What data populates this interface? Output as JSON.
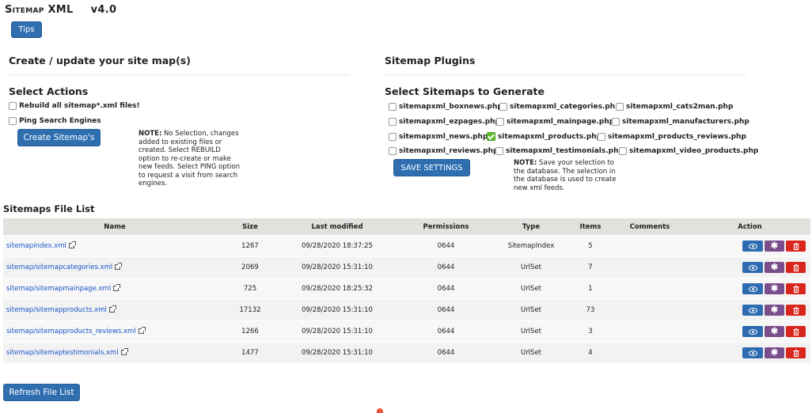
{
  "header": {
    "title": "Sitemap XML",
    "version": "v4.0",
    "tips_label": "Tips"
  },
  "left": {
    "heading": "Create / update your site map(s)",
    "actions_heading": "Select Actions",
    "rebuild_label": "Rebuild all sitemap*.xml files!",
    "ping_label": "Ping Search Engines",
    "create_button": "Create Sitemap's",
    "note_label": "NOTE:",
    "note_text": " No Selection, changes added to existing files or created. Select REBUILD option to re-create or make new feeds. Select PING option to request a visit from search engines."
  },
  "right": {
    "heading": "Sitemap Plugins",
    "select_heading": "Select Sitemaps to Generate",
    "plugins": [
      {
        "label": "sitemapxml_boxnews.php",
        "checked": false
      },
      {
        "label": "sitemapxml_categories.php",
        "checked": false
      },
      {
        "label": "sitemapxml_cats2man.php",
        "checked": false
      },
      {
        "label": "sitemapxml_ezpages.php",
        "checked": false
      },
      {
        "label": "sitemapxml_mainpage.php",
        "checked": false
      },
      {
        "label": "sitemapxml_manufacturers.php",
        "checked": false
      },
      {
        "label": "sitemapxml_news.php",
        "checked": false
      },
      {
        "label": "sitemapxml_products.php",
        "checked": true
      },
      {
        "label": "sitemapxml_products_reviews.php",
        "checked": false
      },
      {
        "label": "sitemapxml_reviews.php",
        "checked": false
      },
      {
        "label": "sitemapxml_testimonials.php",
        "checked": false
      },
      {
        "label": "sitemapxml_video_products.php",
        "checked": false
      }
    ],
    "save_button": "SAVE SETTINGS",
    "note_label": "NOTE:",
    "note_text": " Save your selection to the database. The selection in the database is used to create new xml feeds."
  },
  "file_list": {
    "heading": "Sitemaps File List",
    "columns": [
      "Name",
      "Size",
      "Last modified",
      "Permissions",
      "Type",
      "Items",
      "Comments",
      "Action"
    ],
    "rows": [
      {
        "name": "sitemapindex.xml",
        "size": "1267",
        "modified": "09/28/2020 18:37:25",
        "perms": "0644",
        "type": "SitemapIndex",
        "items": "5",
        "comments": ""
      },
      {
        "name": "sitemap/sitemapcategories.xml",
        "size": "2069",
        "modified": "09/28/2020 15:31:10",
        "perms": "0644",
        "type": "UrlSet",
        "items": "7",
        "comments": ""
      },
      {
        "name": "sitemap/sitemapmainpage.xml",
        "size": "725",
        "modified": "09/28/2020 18:25:32",
        "perms": "0644",
        "type": "UrlSet",
        "items": "1",
        "comments": ""
      },
      {
        "name": "sitemap/sitemapproducts.xml",
        "size": "17132",
        "modified": "09/28/2020 15:31:10",
        "perms": "0644",
        "type": "UrlSet",
        "items": "73",
        "comments": ""
      },
      {
        "name": "sitemap/sitemapproducts_reviews.xml",
        "size": "1266",
        "modified": "09/28/2020 15:31:10",
        "perms": "0644",
        "type": "UrlSet",
        "items": "3",
        "comments": ""
      },
      {
        "name": "sitemap/sitemaptestimonials.xml",
        "size": "1477",
        "modified": "09/28/2020 15:31:10",
        "perms": "0644",
        "type": "UrlSet",
        "items": "4",
        "comments": ""
      }
    ],
    "refresh_button": "Refresh File List"
  },
  "icons": {
    "view": "eye-icon",
    "regenerate": "asterisk-icon",
    "delete": "trash-icon",
    "external": "external-link-icon"
  },
  "colors": {
    "primary": "#2f6fb0",
    "view": "#2e6bb0",
    "regenerate": "#7a4e8c",
    "delete": "#d9261c",
    "checked": "#5bbf2a",
    "link": "#1a55c9",
    "table_header": "#e3e1de"
  }
}
